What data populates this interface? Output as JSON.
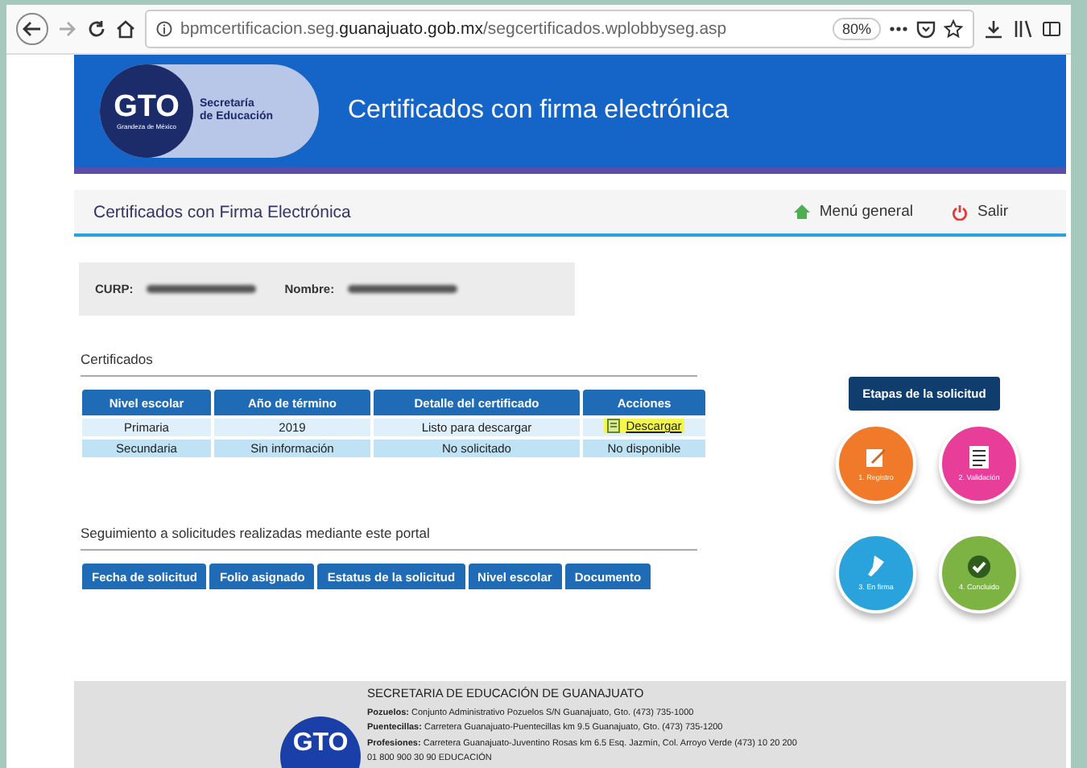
{
  "browser": {
    "url": "bpmcertificacion.seg.**guanajuato.gob.mx**/segcertificados.wplobbyseg.asp",
    "zoom": "80%"
  },
  "header": {
    "logo_text": "GTO",
    "logo_tagline": "Grandeza de México",
    "logo_caption": [
      "Secretaría",
      "de Educación"
    ],
    "title": "Certificados con firma electrónica"
  },
  "nav": {
    "title": "Certificados con Firma Electrónica",
    "links": [
      {
        "kind": "home",
        "label": "Menú general"
      },
      {
        "kind": "power",
        "label": "Salir"
      }
    ]
  },
  "profile": {
    "fields": [
      {
        "label": "CURP:"
      },
      {
        "label": "Nombre:"
      }
    ]
  },
  "certificates": {
    "heading": "Certificados",
    "columns": [
      "Nivel escolar",
      "Año de término",
      "Detalle del certificado",
      "Acciones"
    ],
    "rows": [
      {
        "cells": [
          "Primaria",
          "2019",
          "Listo para descargar"
        ],
        "action": {
          "kind": "link",
          "label": "Descargar",
          "highlighted": true
        }
      },
      {
        "cells": [
          "Secundaria",
          "Sin información",
          "No solicitado"
        ],
        "action": {
          "kind": "text",
          "label": "No disponible",
          "highlighted": false
        }
      }
    ]
  },
  "tracking": {
    "heading": "Seguimiento a solicitudes realizadas mediante este portal",
    "columns": [
      "Fecha de solicitud",
      "Folio asignado",
      "Estatus de la solicitud",
      "Nivel escolar",
      "Documento"
    ]
  },
  "stages": {
    "title": "Etapas de la solicitud",
    "steps": [
      {
        "kind": "edit",
        "label": "1. Registro",
        "color": "#f07a2a"
      },
      {
        "kind": "list",
        "label": "2. Validación",
        "color": "#e83e9a"
      },
      {
        "kind": "pen",
        "label": "3. En firma",
        "color": "#2aa3dc"
      },
      {
        "kind": "check",
        "label": "4. Concluido",
        "color": "#7cb342"
      }
    ]
  },
  "footer": {
    "logo_text": "GTO",
    "heading": "SECRETARIA DE EDUCACIÓN DE GUANAJUATO",
    "lines": [
      {
        "label": "Pozuelos:",
        "text": "Conjunto Administrativo Pozuelos S/N Guanajuato, Gto. (473) 735-1000"
      },
      {
        "label": "Puentecillas:",
        "text": "Carretera Guanajuato-Puentecillas km 9.5 Guanajuato, Gto. (473) 735-1200"
      },
      {
        "label": "Profesiones:",
        "text": "Carretera Guanajuato-Juventino Rosas km 6.5 Esq. Jazmín, Col. Arroyo Verde (473) 10 20 200"
      }
    ],
    "phone": "01 800 900 30 90 EDUCACIÓN"
  }
}
